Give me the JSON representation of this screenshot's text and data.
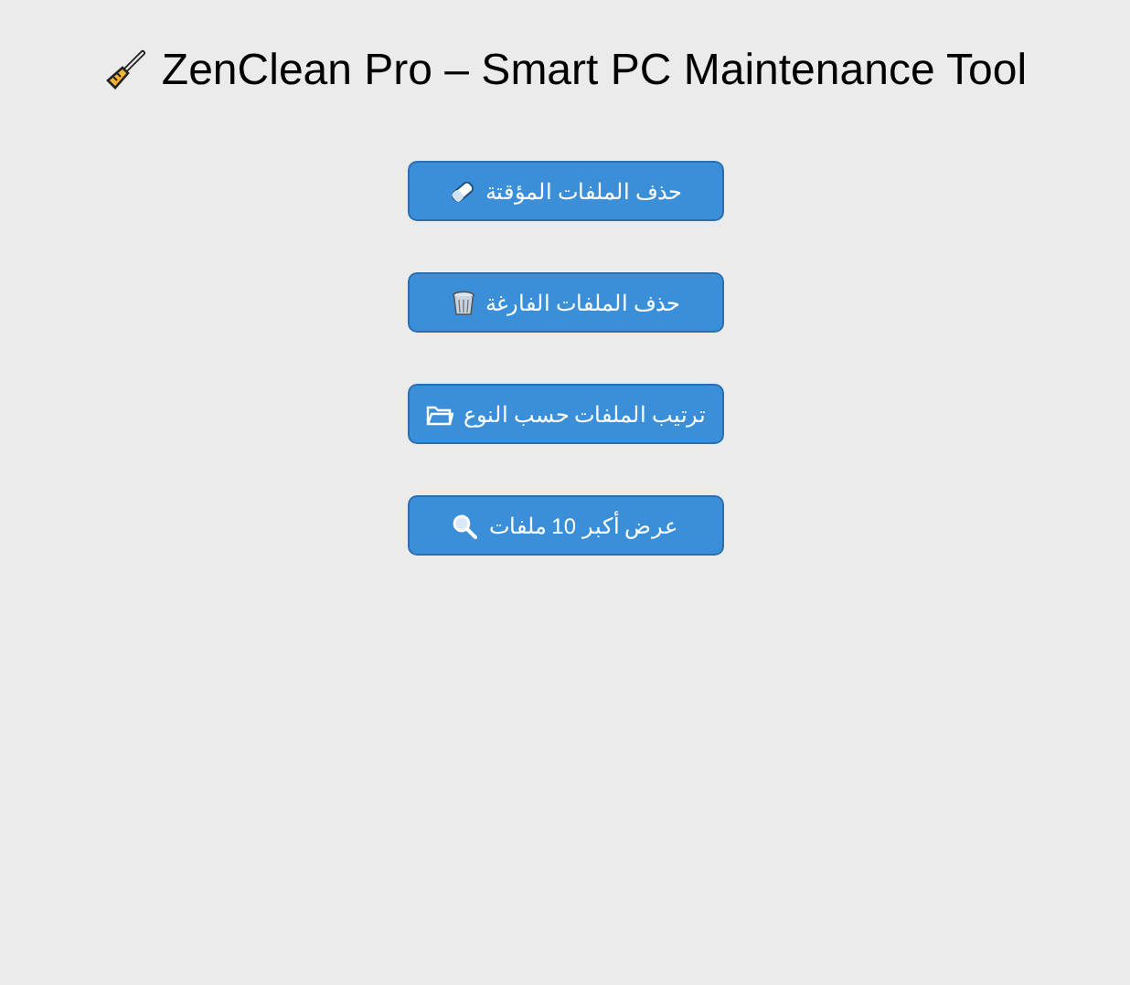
{
  "window": {
    "title": "ZenClean Pro – Smart PC Maintenance Tool"
  },
  "buttons": [
    {
      "label": "حذف الملفات المؤقتة"
    },
    {
      "label": "حذف الملفات الفارغة"
    },
    {
      "label": "ترتيب الملفات حسب النوع"
    },
    {
      "label": "عرض أكبر 10 ملفات"
    }
  ]
}
